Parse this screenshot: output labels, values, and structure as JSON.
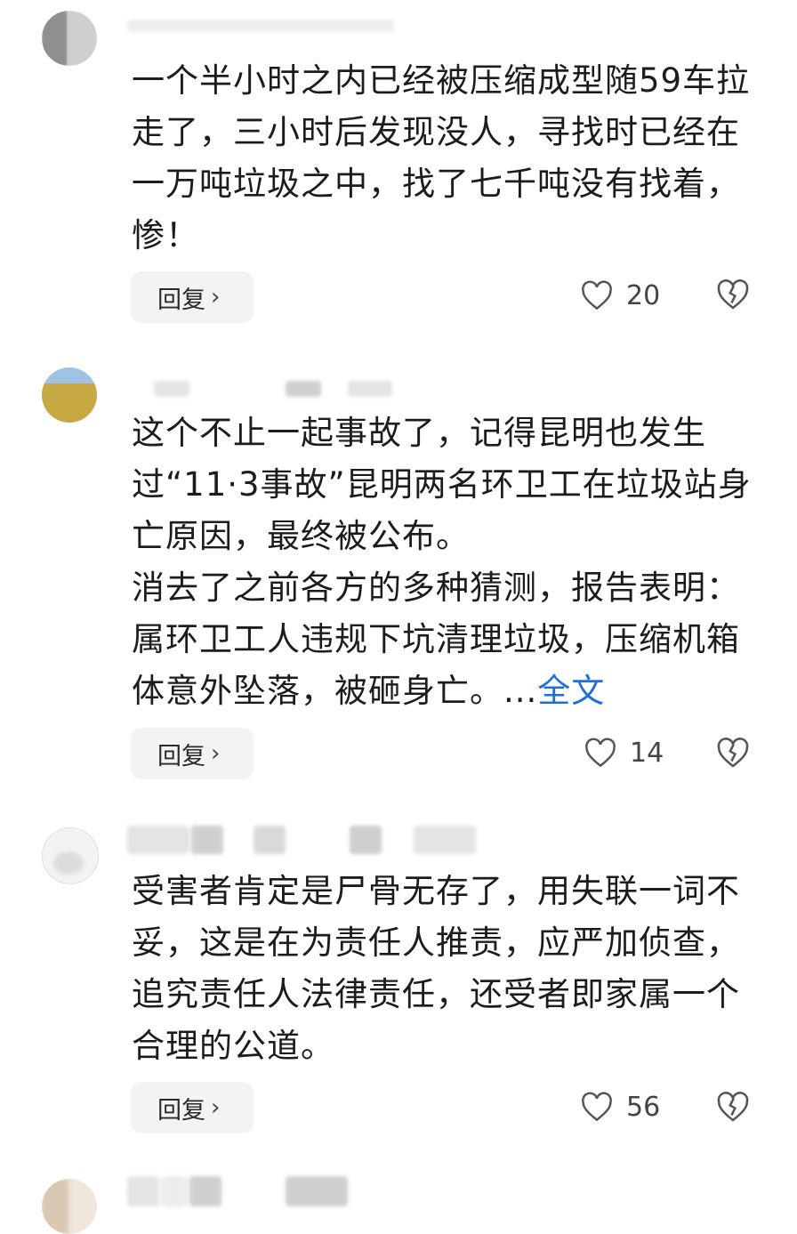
{
  "comments": [
    {
      "text": "一个半小时之内已经被压缩成型随59车拉走了，三小时后发现没人，寻找时已经在一万吨垃圾之中，找了七千吨没有找着，惨！",
      "more_label": "",
      "reply_label": "回复",
      "likes": "20"
    },
    {
      "text": "这个不止一起事故了，记得昆明也发生过“11·3事故”昆明两名环卫工在垃圾站身亡原因，最终被公布。\n消去了之前各方的多种猜测，报告表明：属环卫工人违规下坑清理垃圾，压缩机箱体意外坠落，被砸身亡。...",
      "more_label": "全文",
      "reply_label": "回复",
      "likes": "14"
    },
    {
      "text": "受害者肯定是尸骨无存了，用失联一词不妥，这是在为责任人推责，应严加侦查，追究责任人法律责任，还受者即家属一个合理的公道。",
      "more_label": "",
      "reply_label": "回复",
      "likes": "56"
    }
  ],
  "icons": {
    "like": "heart-outline-icon",
    "dislike": "broken-heart-icon",
    "reply_chevron": "chevron-right-icon"
  },
  "colors": {
    "link": "#1e6fd9",
    "reply_bg": "#f2f3f5"
  }
}
